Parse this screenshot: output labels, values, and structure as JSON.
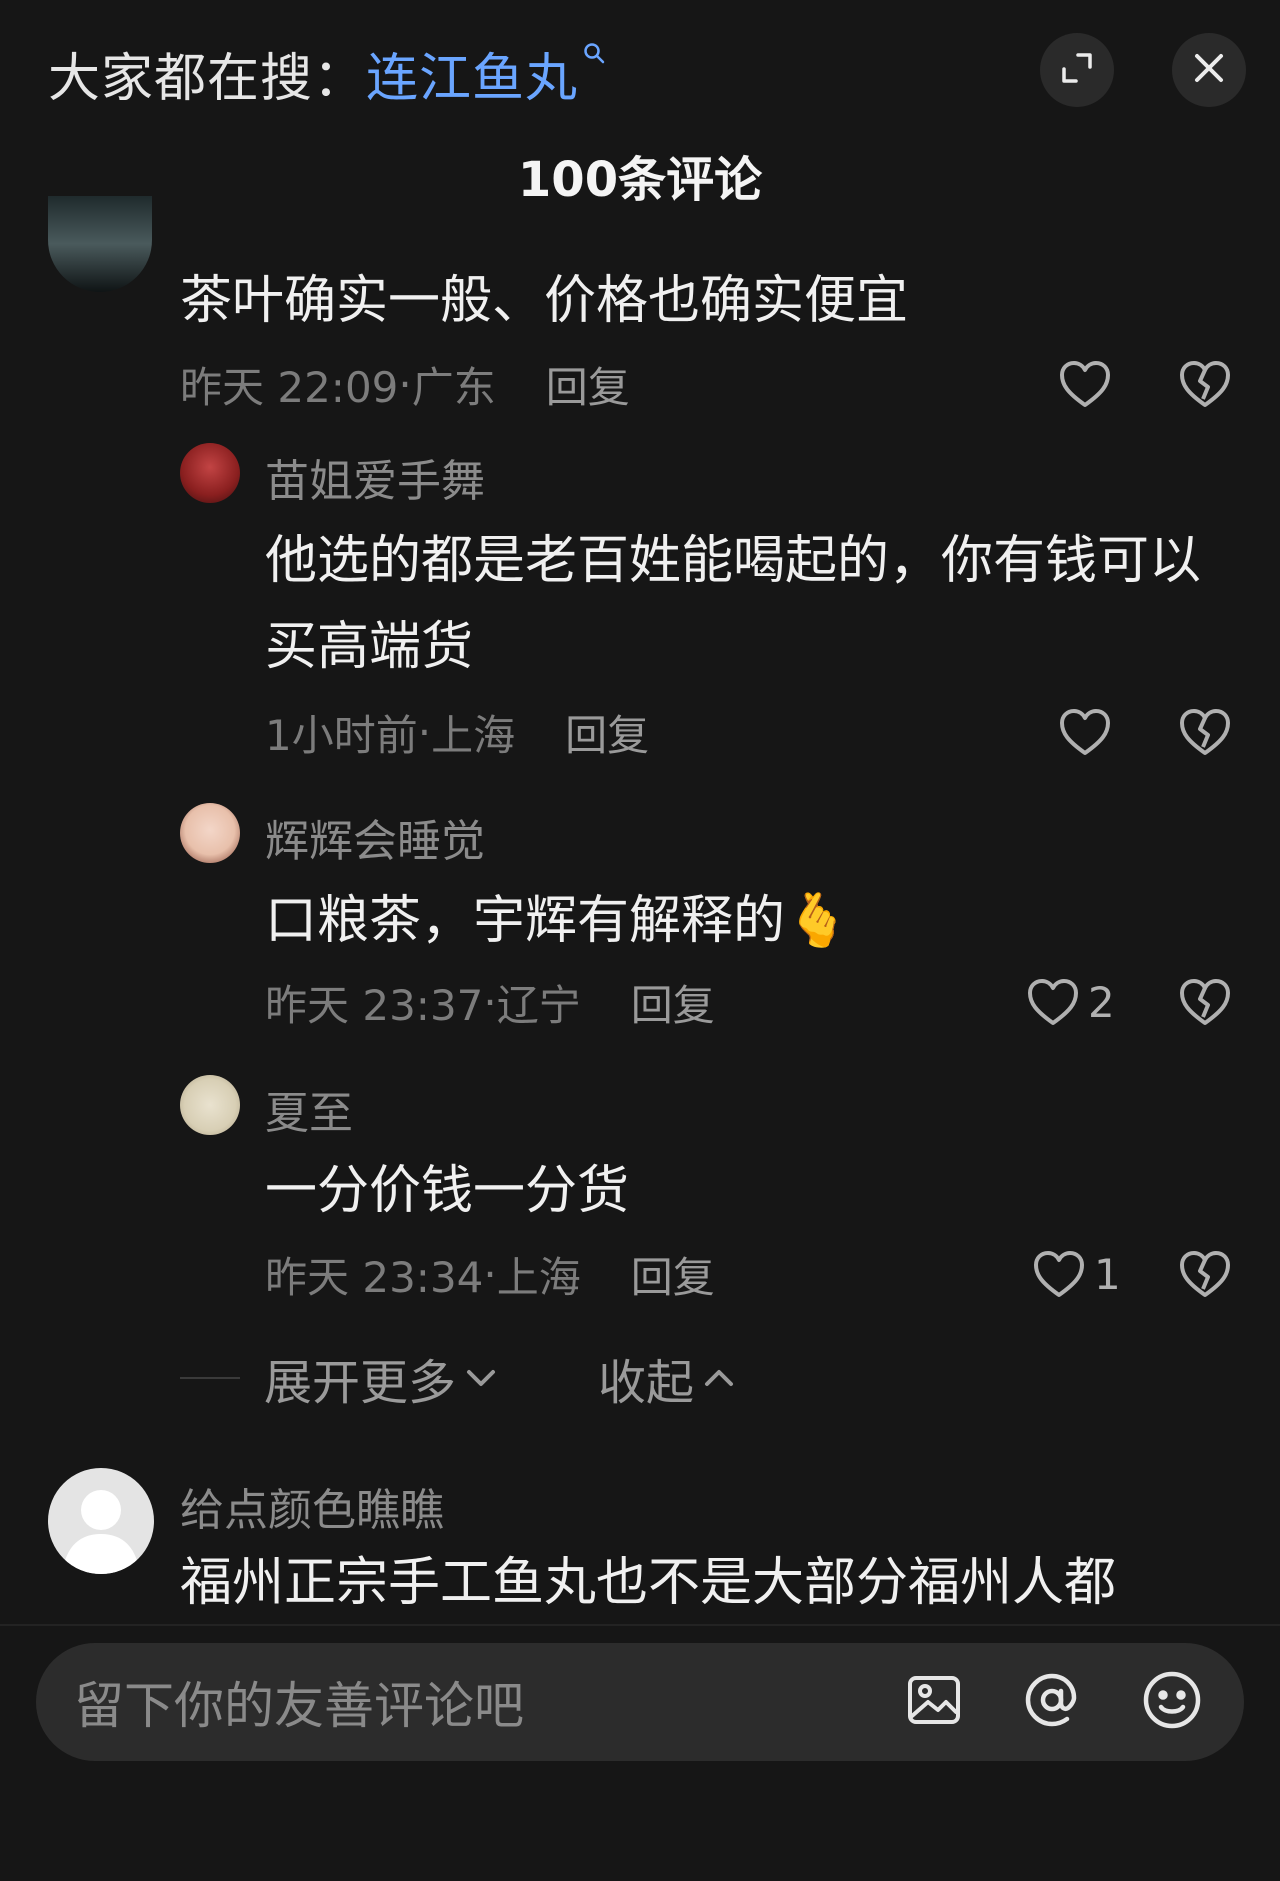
{
  "header": {
    "search_prefix": "大家都在搜：",
    "search_term": "连江鱼丸",
    "search_icon": "search-icon",
    "expand_icon": "expand-icon",
    "close_icon": "close-icon",
    "comment_count_title": "100条评论"
  },
  "comments": [
    {
      "text": "茶叶确实一般、价格也确实便宜",
      "time": "昨天 22:09",
      "location": "广东",
      "reply_label": "回复",
      "likes": ""
    }
  ],
  "replies": [
    {
      "name": "苗姐爱手舞",
      "text": "他选的都是老百姓能喝起的，你有钱可以买高端货",
      "time": "1小时前",
      "location": "上海",
      "reply_label": "回复",
      "likes": ""
    },
    {
      "name": "辉辉会睡觉",
      "text": "口粮茶，宇辉有解释的",
      "emoji": "🫰",
      "time": "昨天 23:37",
      "location": "辽宁",
      "reply_label": "回复",
      "likes": "2"
    },
    {
      "name": "夏至",
      "text": "一分价钱一分货",
      "time": "昨天 23:34",
      "location": "上海",
      "reply_label": "回复",
      "likes": "1"
    }
  ],
  "expand": {
    "more_label": "展开更多",
    "collapse_label": "收起"
  },
  "next_comment": {
    "name": "给点颜色瞧瞧",
    "text": "福州正宗手工鱼丸也不是大部分福州人都"
  },
  "composer": {
    "placeholder": "留下你的友善评论吧",
    "icons": [
      "image-icon",
      "mention-icon",
      "emoji-icon"
    ]
  },
  "colors": {
    "accent": "#6aa5ff",
    "background": "#161616",
    "input_bg": "#2c2c2c"
  }
}
